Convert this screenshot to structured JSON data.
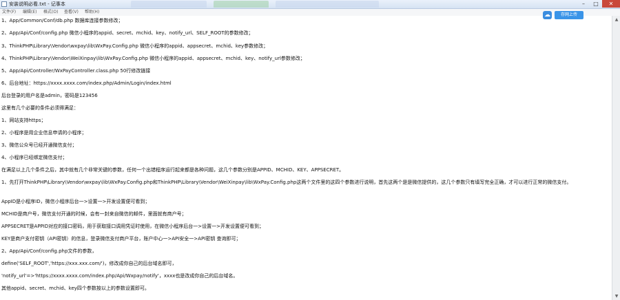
{
  "window": {
    "title": "安装说明必看.txt - 记事本",
    "minimize": "–",
    "maximize": "□",
    "close": "✕"
  },
  "menu": [
    "文件(F)",
    "编辑(E)",
    "格式(O)",
    "查看(V)",
    "帮助(H)"
  ],
  "upload": {
    "label": "存网上传",
    "icon": "cloud-upload-icon"
  },
  "content": {
    "lines": [
      "1、App/Common/Conf/db.php 数据库连接参数修改；",
      "2、App/Api/Conf/config.php 微信小程序的appid、secret、mchid、key、notify_url、SELF_ROOT的参数修改；",
      "3、ThinkPHP\\Library\\Vendor\\wxpay\\lib\\WxPay.Config.php 微信小程序的appid、appsecret、mchid、key参数修改；",
      "4、ThinkPHP\\Library\\Vendor\\WeiXinpay\\lib\\WxPay.Config.php 微信小程序的appid、appsecret、mchid、key、notify_url参数修改；",
      "5、App/Api/Controller/WxPayController.class.php 50行修改链接",
      "6、后台地址：https://xxxx.xxxx.com/index.php/Admin/Login/index.html",
      "后台登录的用户名是admin，密码是123456",
      "这里有几个必要的条件必须得满足：",
      "1、网站支持https；",
      "2、小程序是用企业信息申请的小程序；",
      "3、微信公众号已经开通微信支付；",
      "4、小程序已经绑定微信支付；",
      "在满足以上几个条件之后，其中就有几个非常关键的参数，任何一个出错程序运行起来都是各种问题，这几个参数分别是APPID、MCHID、KEY、APPSECRET。",
      "1、先打开ThinkPHP\\Library\\Vendor\\wxpay\\lib\\WxPay.Config.php和ThinkPHP\\Library\\Vendor\\WeiXinpay\\lib\\WxPay.Config.php这两个文件里的这四个参数进行说明，首先这两个是是微信提供的，这几个参数只有填写完全正确，才可以进行正常的微信支付。",
      "AppID是小程序ID，微信小程序后台一>设置一>开发设置便可看到；",
      "MCHID是商户号，微信支付开通的时候，会有一封来自微信的邮件，里面就有商户号；",
      "APPSECRET是APPID对应的接口密码，用于获取接口调用凭证时使用，在微信小程序后台一>设置一>开发设置便可看到；",
      "KEY是商户支付密钥（API密钥）的信息，登录微信支付商户平台，账户中心一>API安全一>API密钥 查询即可；",
      "2、App/Api/Conf/config.php文件的参数，",
      "define('SELF_ROOT','https://xxx.xxx.com/')，修改成你自己的后台域名即可，",
      "'notify_url'=>'https://xxxx.xxxx.com/index.php/Api/Wxpay/notify'，xxxx也是改成你自己的后台域名。",
      "其他appid、secret、mchid、key四个参数按以上的参数设置即可。"
    ]
  }
}
